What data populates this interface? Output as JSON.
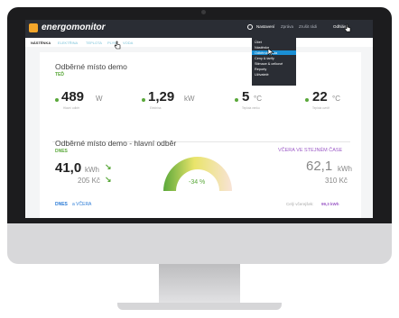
{
  "app": {
    "name": "energomonitor"
  },
  "topbar": {
    "menu": [
      "Nastavení",
      "Zpráva",
      "Zrušit rádi",
      "Odhlás"
    ],
    "user_label": "Odhlásit"
  },
  "subnav": {
    "tabs": [
      "NÁSTĚNKA",
      "ELEKTŘINA",
      "TEPLOTA",
      "PLYN",
      "VODA"
    ]
  },
  "dropdown": {
    "items": [
      "Účet",
      "Nástěnka",
      "Odběrná místa",
      "Ceny & tarify",
      "Stimace & celkové",
      "Reporty",
      "Uživatelé"
    ]
  },
  "card1": {
    "title": "Odběrné místo demo",
    "subtitle": "TEĎ",
    "metrics": [
      {
        "value": "489",
        "unit": "W",
        "caption": "Hlavní odběr"
      },
      {
        "value": "1,29",
        "unit": "kW",
        "caption": "Elektrina"
      },
      {
        "value": "5",
        "unit": "°C",
        "caption": "Teplota venku"
      },
      {
        "value": "22",
        "unit": "°C",
        "caption": "Teplota uvnitř"
      }
    ]
  },
  "card2": {
    "title": "Odběrné místo demo - hlavní odběr",
    "today_label": "DNES",
    "today_value": "41,0",
    "today_unit": "kWh",
    "today_cost": "205 Kč",
    "gauge_label": "-34 %",
    "gauge_fraction": 0.35,
    "yesterday_label": "VČERA VE STEJNÉM ČASE",
    "yesterday_value": "62,1",
    "yesterday_unit": "kWh",
    "yesterday_cost": "310 Kč",
    "bottom_left_a": "DNES",
    "bottom_left_b": "a VČERA",
    "bottom_right_label": "Celý včerejšek:",
    "bottom_right_value": "99,3 kWh"
  },
  "colors": {
    "accent": "#5aa83a",
    "brand": "#f4a62a",
    "purple": "#9b59c6",
    "blue": "#2b7bd6"
  }
}
